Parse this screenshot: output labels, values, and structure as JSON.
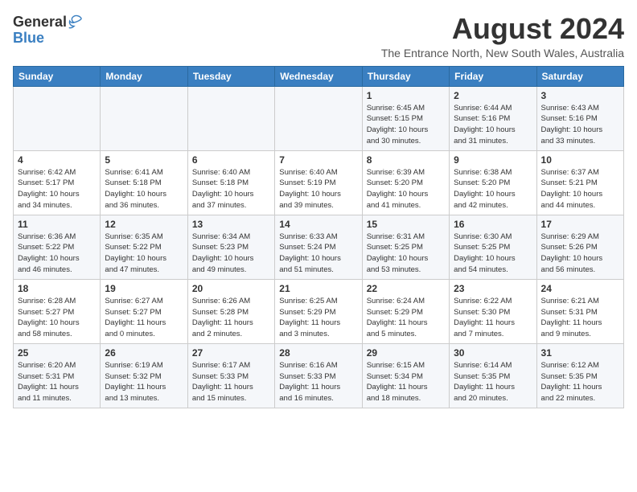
{
  "header": {
    "logo": {
      "general": "General",
      "blue": "Blue"
    },
    "title": "August 2024",
    "subtitle": "The Entrance North, New South Wales, Australia"
  },
  "weekdays": [
    "Sunday",
    "Monday",
    "Tuesday",
    "Wednesday",
    "Thursday",
    "Friday",
    "Saturday"
  ],
  "weeks": [
    [
      {
        "day": "",
        "info": ""
      },
      {
        "day": "",
        "info": ""
      },
      {
        "day": "",
        "info": ""
      },
      {
        "day": "",
        "info": ""
      },
      {
        "day": "1",
        "info": "Sunrise: 6:45 AM\nSunset: 5:15 PM\nDaylight: 10 hours\nand 30 minutes."
      },
      {
        "day": "2",
        "info": "Sunrise: 6:44 AM\nSunset: 5:16 PM\nDaylight: 10 hours\nand 31 minutes."
      },
      {
        "day": "3",
        "info": "Sunrise: 6:43 AM\nSunset: 5:16 PM\nDaylight: 10 hours\nand 33 minutes."
      }
    ],
    [
      {
        "day": "4",
        "info": "Sunrise: 6:42 AM\nSunset: 5:17 PM\nDaylight: 10 hours\nand 34 minutes."
      },
      {
        "day": "5",
        "info": "Sunrise: 6:41 AM\nSunset: 5:18 PM\nDaylight: 10 hours\nand 36 minutes."
      },
      {
        "day": "6",
        "info": "Sunrise: 6:40 AM\nSunset: 5:18 PM\nDaylight: 10 hours\nand 37 minutes."
      },
      {
        "day": "7",
        "info": "Sunrise: 6:40 AM\nSunset: 5:19 PM\nDaylight: 10 hours\nand 39 minutes."
      },
      {
        "day": "8",
        "info": "Sunrise: 6:39 AM\nSunset: 5:20 PM\nDaylight: 10 hours\nand 41 minutes."
      },
      {
        "day": "9",
        "info": "Sunrise: 6:38 AM\nSunset: 5:20 PM\nDaylight: 10 hours\nand 42 minutes."
      },
      {
        "day": "10",
        "info": "Sunrise: 6:37 AM\nSunset: 5:21 PM\nDaylight: 10 hours\nand 44 minutes."
      }
    ],
    [
      {
        "day": "11",
        "info": "Sunrise: 6:36 AM\nSunset: 5:22 PM\nDaylight: 10 hours\nand 46 minutes."
      },
      {
        "day": "12",
        "info": "Sunrise: 6:35 AM\nSunset: 5:22 PM\nDaylight: 10 hours\nand 47 minutes."
      },
      {
        "day": "13",
        "info": "Sunrise: 6:34 AM\nSunset: 5:23 PM\nDaylight: 10 hours\nand 49 minutes."
      },
      {
        "day": "14",
        "info": "Sunrise: 6:33 AM\nSunset: 5:24 PM\nDaylight: 10 hours\nand 51 minutes."
      },
      {
        "day": "15",
        "info": "Sunrise: 6:31 AM\nSunset: 5:25 PM\nDaylight: 10 hours\nand 53 minutes."
      },
      {
        "day": "16",
        "info": "Sunrise: 6:30 AM\nSunset: 5:25 PM\nDaylight: 10 hours\nand 54 minutes."
      },
      {
        "day": "17",
        "info": "Sunrise: 6:29 AM\nSunset: 5:26 PM\nDaylight: 10 hours\nand 56 minutes."
      }
    ],
    [
      {
        "day": "18",
        "info": "Sunrise: 6:28 AM\nSunset: 5:27 PM\nDaylight: 10 hours\nand 58 minutes."
      },
      {
        "day": "19",
        "info": "Sunrise: 6:27 AM\nSunset: 5:27 PM\nDaylight: 11 hours\nand 0 minutes."
      },
      {
        "day": "20",
        "info": "Sunrise: 6:26 AM\nSunset: 5:28 PM\nDaylight: 11 hours\nand 2 minutes."
      },
      {
        "day": "21",
        "info": "Sunrise: 6:25 AM\nSunset: 5:29 PM\nDaylight: 11 hours\nand 3 minutes."
      },
      {
        "day": "22",
        "info": "Sunrise: 6:24 AM\nSunset: 5:29 PM\nDaylight: 11 hours\nand 5 minutes."
      },
      {
        "day": "23",
        "info": "Sunrise: 6:22 AM\nSunset: 5:30 PM\nDaylight: 11 hours\nand 7 minutes."
      },
      {
        "day": "24",
        "info": "Sunrise: 6:21 AM\nSunset: 5:31 PM\nDaylight: 11 hours\nand 9 minutes."
      }
    ],
    [
      {
        "day": "25",
        "info": "Sunrise: 6:20 AM\nSunset: 5:31 PM\nDaylight: 11 hours\nand 11 minutes."
      },
      {
        "day": "26",
        "info": "Sunrise: 6:19 AM\nSunset: 5:32 PM\nDaylight: 11 hours\nand 13 minutes."
      },
      {
        "day": "27",
        "info": "Sunrise: 6:17 AM\nSunset: 5:33 PM\nDaylight: 11 hours\nand 15 minutes."
      },
      {
        "day": "28",
        "info": "Sunrise: 6:16 AM\nSunset: 5:33 PM\nDaylight: 11 hours\nand 16 minutes."
      },
      {
        "day": "29",
        "info": "Sunrise: 6:15 AM\nSunset: 5:34 PM\nDaylight: 11 hours\nand 18 minutes."
      },
      {
        "day": "30",
        "info": "Sunrise: 6:14 AM\nSunset: 5:35 PM\nDaylight: 11 hours\nand 20 minutes."
      },
      {
        "day": "31",
        "info": "Sunrise: 6:12 AM\nSunset: 5:35 PM\nDaylight: 11 hours\nand 22 minutes."
      }
    ]
  ]
}
